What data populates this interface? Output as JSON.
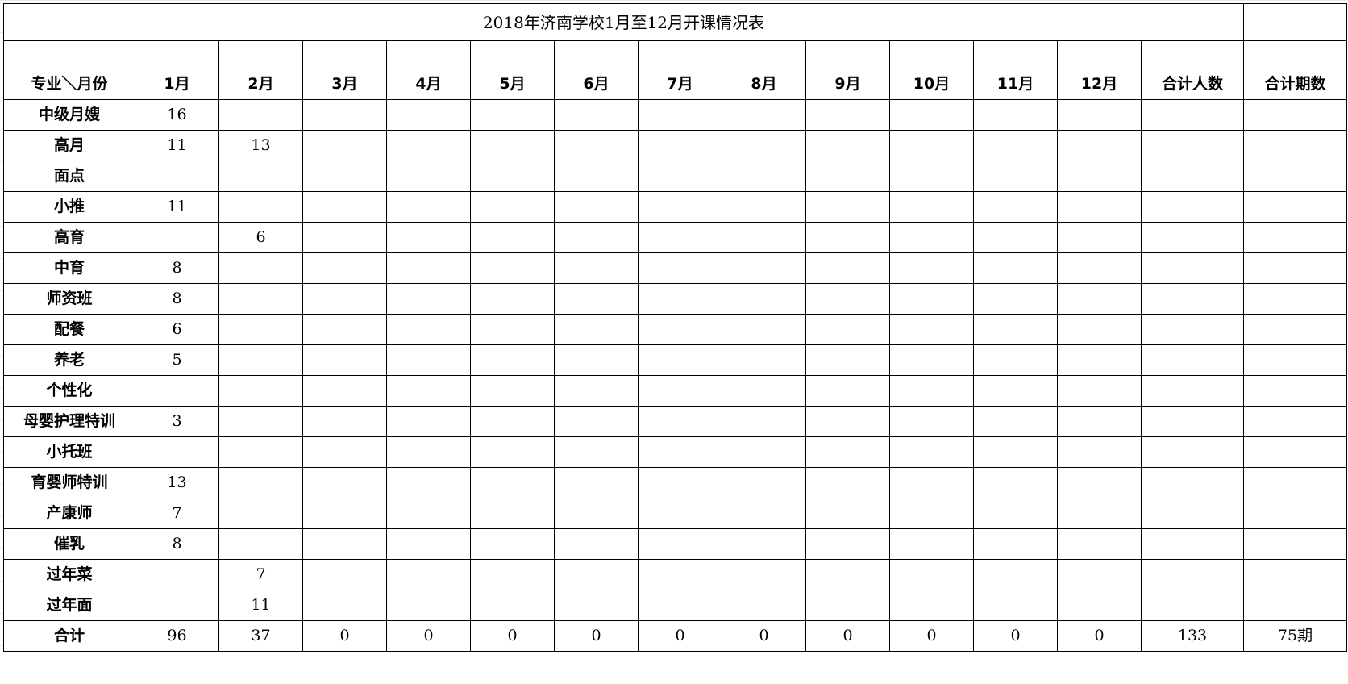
{
  "title": "2018年济南学校1月至12月开课情况表",
  "headers": {
    "corner": "专业＼月份",
    "months": [
      "1月",
      "2月",
      "3月",
      "4月",
      "5月",
      "6月",
      "7月",
      "8月",
      "9月",
      "10月",
      "11月",
      "12月"
    ],
    "total_people": "合计人数",
    "total_periods": "合计期数"
  },
  "rows": [
    {
      "label": "中级月嫂",
      "values": [
        "16",
        "",
        "",
        "",
        "",
        "",
        "",
        "",
        "",
        "",
        "",
        ""
      ]
    },
    {
      "label": "高月",
      "values": [
        "11",
        "13",
        "",
        "",
        "",
        "",
        "",
        "",
        "",
        "",
        "",
        ""
      ]
    },
    {
      "label": "面点",
      "values": [
        "",
        "",
        "",
        "",
        "",
        "",
        "",
        "",
        "",
        "",
        "",
        ""
      ]
    },
    {
      "label": "小推",
      "values": [
        "11",
        "",
        "",
        "",
        "",
        "",
        "",
        "",
        "",
        "",
        "",
        ""
      ]
    },
    {
      "label": "高育",
      "values": [
        "",
        "6",
        "",
        "",
        "",
        "",
        "",
        "",
        "",
        "",
        "",
        ""
      ]
    },
    {
      "label": "中育",
      "values": [
        "8",
        "",
        "",
        "",
        "",
        "",
        "",
        "",
        "",
        "",
        "",
        ""
      ]
    },
    {
      "label": "师资班",
      "values": [
        "8",
        "",
        "",
        "",
        "",
        "",
        "",
        "",
        "",
        "",
        "",
        ""
      ]
    },
    {
      "label": "配餐",
      "values": [
        "6",
        "",
        "",
        "",
        "",
        "",
        "",
        "",
        "",
        "",
        "",
        ""
      ]
    },
    {
      "label": "养老",
      "values": [
        "5",
        "",
        "",
        "",
        "",
        "",
        "",
        "",
        "",
        "",
        "",
        ""
      ]
    },
    {
      "label": "个性化",
      "values": [
        "",
        "",
        "",
        "",
        "",
        "",
        "",
        "",
        "",
        "",
        "",
        ""
      ]
    },
    {
      "label": "母婴护理特训",
      "values": [
        "3",
        "",
        "",
        "",
        "",
        "",
        "",
        "",
        "",
        "",
        "",
        ""
      ]
    },
    {
      "label": "小托班",
      "values": [
        "",
        "",
        "",
        "",
        "",
        "",
        "",
        "",
        "",
        "",
        "",
        ""
      ]
    },
    {
      "label": "育婴师特训",
      "values": [
        "13",
        "",
        "",
        "",
        "",
        "",
        "",
        "",
        "",
        "",
        "",
        ""
      ]
    },
    {
      "label": "产康师",
      "values": [
        "7",
        "",
        "",
        "",
        "",
        "",
        "",
        "",
        "",
        "",
        "",
        ""
      ]
    },
    {
      "label": "催乳",
      "values": [
        "8",
        "",
        "",
        "",
        "",
        "",
        "",
        "",
        "",
        "",
        "",
        ""
      ]
    },
    {
      "label": "过年菜",
      "values": [
        "",
        "7",
        "",
        "",
        "",
        "",
        "",
        "",
        "",
        "",
        "",
        ""
      ]
    },
    {
      "label": "过年面",
      "values": [
        "",
        "11",
        "",
        "",
        "",
        "",
        "",
        "",
        "",
        "",
        "",
        ""
      ]
    }
  ],
  "total_row": {
    "label": "合计",
    "values": [
      "96",
      "37",
      "0",
      "0",
      "0",
      "0",
      "0",
      "0",
      "0",
      "0",
      "0",
      "0"
    ],
    "total_people": "133",
    "total_periods": "75期"
  }
}
